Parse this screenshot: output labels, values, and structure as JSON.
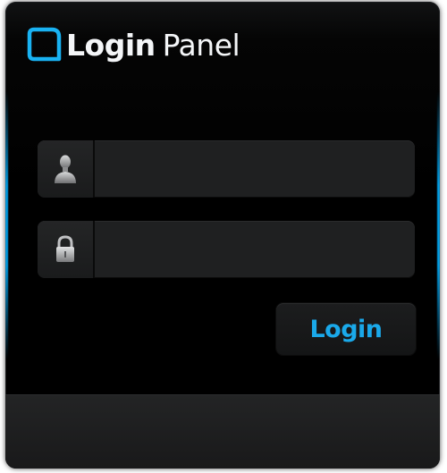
{
  "header": {
    "title_bold": "Login",
    "title_light": "Panel",
    "logo_icon": "rounded-square-logo-icon"
  },
  "form": {
    "username": {
      "icon": "user-icon",
      "value": "",
      "placeholder": ""
    },
    "password": {
      "icon": "lock-icon",
      "value": "",
      "placeholder": ""
    },
    "submit_label": "Login"
  },
  "colors": {
    "accent": "#1aa9ea",
    "panel_bg": "#000000",
    "field_bg": "#1f2021",
    "footer_bg": "#1e1f20"
  }
}
